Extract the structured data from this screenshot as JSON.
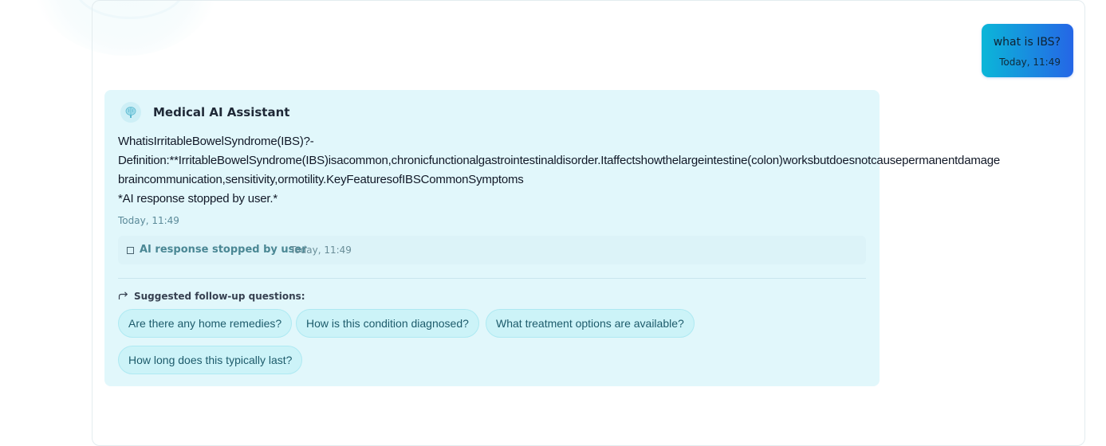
{
  "user_message": {
    "text": "what is IBS?",
    "time": "Today, 11:49"
  },
  "assistant": {
    "name": "Medical AI Assistant",
    "avatar_icon": "brain-icon",
    "response_lines": [
      "WhatisIrritableBowelSyndrome(IBS)?-",
      "Definition:**IrritableBowelSyndrome(IBS)isacommon,chronicfunctionalgastrointestinaldisorder.Itaffectshowthelargeintestine(colon)worksbutdoesnotcausepermanentdamage",
      "braincommunication,sensitivity,ormotility.KeyFeaturesofIBSCommonSymptoms",
      "*AI response stopped by user.*"
    ],
    "time": "Today, 11:49",
    "stopped_notice": {
      "icon": "stop-square-icon",
      "label": "AI response stopped by user",
      "time": "Today, 11:49"
    }
  },
  "followups": {
    "icon": "arrow-forward-icon",
    "heading": "Suggested follow-up questions:",
    "questions": [
      "Are there any home remedies?",
      "How is this condition diagnosed?",
      "What treatment options are available?",
      "How long does this typically last?"
    ]
  },
  "colors": {
    "user_bubble_start": "#0bb6d8",
    "user_bubble_end": "#2566e6",
    "assistant_card_bg": "#e1f7fb",
    "chip_bg": "#ccf3f8",
    "chip_border": "#aee9f2"
  }
}
